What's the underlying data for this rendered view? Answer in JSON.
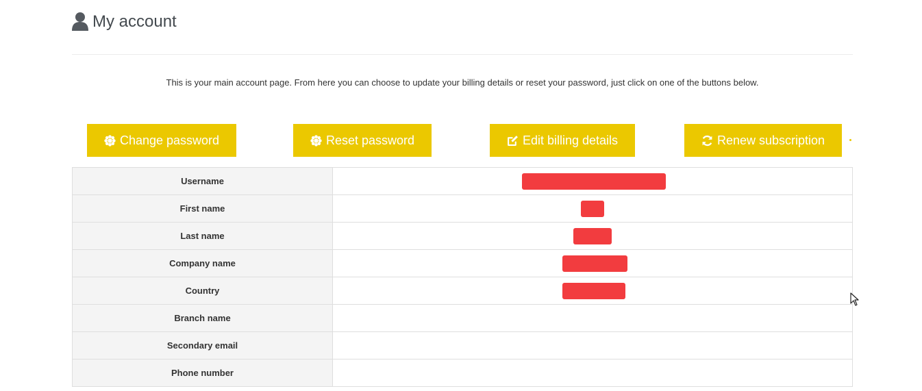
{
  "header": {
    "icon": "user-icon",
    "title": "My account"
  },
  "intro": "This is your main account page. From here you can choose to update your billing details or reset your password, just click on one of the buttons below.",
  "buttons": [
    {
      "label": "Change password",
      "icon": "asterisk-icon"
    },
    {
      "label": "Reset password",
      "icon": "asterisk-icon"
    },
    {
      "label": "Edit billing details",
      "icon": "edit-icon"
    },
    {
      "label": "Renew subscription",
      "icon": "refresh-icon"
    }
  ],
  "colors": {
    "accent": "#ebc800",
    "redaction": "#f23c3f",
    "label_bg": "#f4f4f4"
  },
  "account_rows": [
    {
      "label": "Username",
      "value_redacted": true
    },
    {
      "label": "First name",
      "value_redacted": true
    },
    {
      "label": "Last name",
      "value_redacted": true
    },
    {
      "label": "Company name",
      "value_redacted": true
    },
    {
      "label": "Country",
      "value_redacted": true
    },
    {
      "label": "Branch name",
      "value_redacted": false
    },
    {
      "label": "Secondary email",
      "value_redacted": false
    },
    {
      "label": "Phone number",
      "value_redacted": false
    }
  ]
}
